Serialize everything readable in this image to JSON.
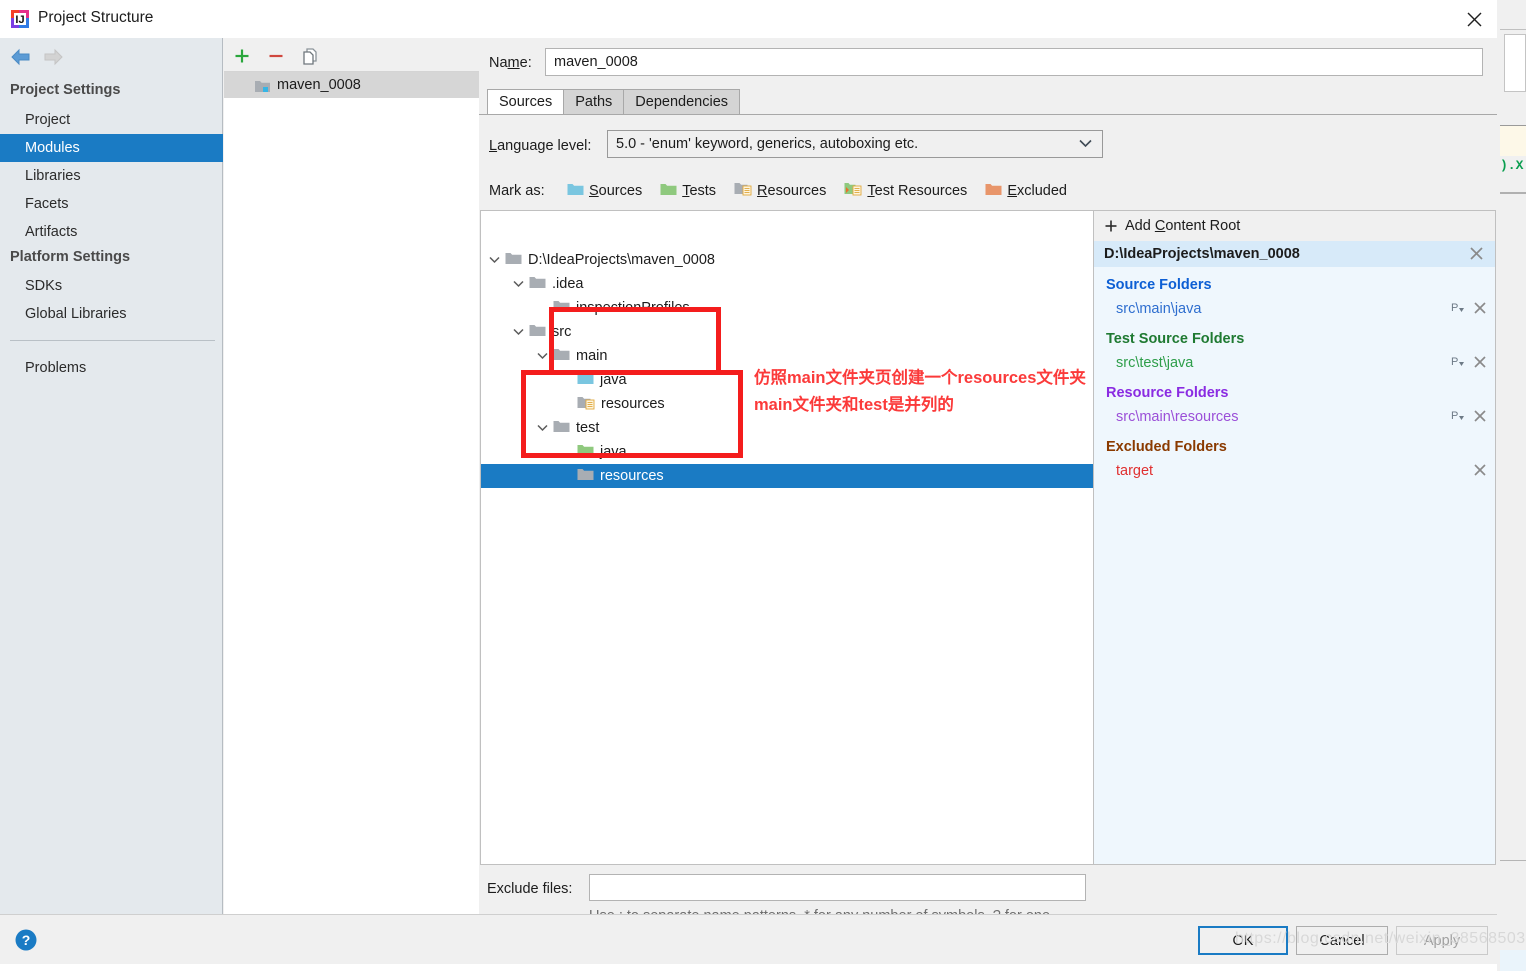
{
  "window": {
    "title": "Project Structure",
    "close_icon": "close-icon",
    "app_icon": "intellij-idea-icon"
  },
  "navigation": {
    "back_icon": "arrow-left-icon",
    "forward_icon": "arrow-right-icon"
  },
  "sidebar": {
    "groups": [
      {
        "label": "Project Settings"
      },
      {
        "label": "Platform Settings"
      }
    ],
    "items": [
      {
        "label": "Project",
        "selected": false
      },
      {
        "label": "Modules",
        "selected": true
      },
      {
        "label": "Libraries",
        "selected": false
      },
      {
        "label": "Facets",
        "selected": false
      },
      {
        "label": "Artifacts",
        "selected": false
      },
      {
        "label": "SDKs",
        "selected": false
      },
      {
        "label": "Global Libraries",
        "selected": false
      },
      {
        "label": "Problems",
        "selected": false
      }
    ]
  },
  "modules_panel": {
    "toolbar": {
      "add_icon": "plus-icon",
      "remove_icon": "minus-icon",
      "copy_icon": "copy-icon"
    },
    "module_name": "maven_0008",
    "module_icon": "module-folder-icon"
  },
  "main": {
    "name_label": "Name:",
    "name_value": "maven_0008",
    "tabs": [
      {
        "label": "Sources",
        "active": true
      },
      {
        "label": "Paths",
        "active": false
      },
      {
        "label": "Dependencies",
        "active": false
      }
    ],
    "language_level_label": "Language level:",
    "language_level_value": "5.0 - 'enum' keyword, generics, autoboxing etc.",
    "language_level_caret": "chevron-down-icon",
    "mark_as_label": "Mark as:",
    "mark_as_options": [
      {
        "label": "Sources",
        "color": "#7ac6e0",
        "icon": "sources-folder-icon",
        "accel": "S"
      },
      {
        "label": "Tests",
        "color": "#8fc97e",
        "icon": "tests-folder-icon",
        "accel": "T"
      },
      {
        "label": "Resources",
        "color": "#a8adb3",
        "icon": "resources-folder-icon",
        "accel": "R"
      },
      {
        "label": "Test Resources",
        "color": "#8fc97e",
        "icon": "test-resources-folder-icon",
        "accel": "T"
      },
      {
        "label": "Excluded",
        "color": "#e8956a",
        "icon": "excluded-folder-icon",
        "accel": "E"
      }
    ],
    "exclude_files_label": "Exclude files:",
    "exclude_files_value": "",
    "exclude_files_hint": "Use ; to separate name patterns, * for any number of symbols, ? for one."
  },
  "tree": {
    "rows": [
      {
        "label": "D:\\IdeaProjects\\maven_0008",
        "depth": 0,
        "twisty": "expanded",
        "folder": "plain",
        "selected": false
      },
      {
        "label": ".idea",
        "depth": 1,
        "twisty": "expanded",
        "folder": "plain",
        "selected": false
      },
      {
        "label": "inspectionProfiles",
        "depth": 2,
        "twisty": "none",
        "folder": "plain",
        "selected": false
      },
      {
        "label": "src",
        "depth": 1,
        "twisty": "expanded",
        "folder": "plain",
        "selected": false
      },
      {
        "label": "main",
        "depth": 2,
        "twisty": "expanded",
        "folder": "plain",
        "selected": false
      },
      {
        "label": "java",
        "depth": 3,
        "twisty": "none",
        "folder": "sources",
        "selected": false
      },
      {
        "label": "resources",
        "depth": 3,
        "twisty": "none",
        "folder": "resources",
        "selected": false
      },
      {
        "label": "test",
        "depth": 2,
        "twisty": "expanded",
        "folder": "plain",
        "selected": false
      },
      {
        "label": "java",
        "depth": 3,
        "twisty": "none",
        "folder": "tests",
        "selected": false
      },
      {
        "label": "resources",
        "depth": 3,
        "twisty": "none",
        "folder": "plain",
        "selected": true
      }
    ]
  },
  "content_root": {
    "add_label": "Add Content Root",
    "add_icon": "plus-icon",
    "root_path": "D:\\IdeaProjects\\maven_0008",
    "root_remove_icon": "close-icon",
    "sections": [
      {
        "header": "Source Folders",
        "header_color": "#0d5fd4",
        "paths": [
          {
            "path": "src\\main\\java",
            "color": "#2e6ecf",
            "has_package_prefix": true,
            "has_remove": true
          }
        ]
      },
      {
        "header": "Test Source Folders",
        "header_color": "#1f7a32",
        "paths": [
          {
            "path": "src\\test\\java",
            "color": "#2e9e4a",
            "has_package_prefix": true,
            "has_remove": true
          }
        ]
      },
      {
        "header": "Resource Folders",
        "header_color": "#8a2be2",
        "paths": [
          {
            "path": "src\\main\\resources",
            "color": "#9b4fd8",
            "has_package_prefix": true,
            "has_remove": true
          }
        ]
      },
      {
        "header": "Excluded Folders",
        "header_color": "#8a3a00",
        "paths": [
          {
            "path": "target",
            "color": "#e03030",
            "has_package_prefix": false,
            "has_remove": true
          }
        ]
      }
    ]
  },
  "footer": {
    "help_icon": "help-icon",
    "buttons": [
      {
        "label": "OK",
        "primary": true,
        "enabled": true
      },
      {
        "label": "Cancel",
        "primary": false,
        "enabled": true
      },
      {
        "label": "Apply",
        "primary": false,
        "enabled": false
      }
    ]
  },
  "annotations": {
    "color": "#fb3a3a",
    "box_color": "#f41d1d",
    "line1": "仿照main文件夹页创建一个resources文件夹",
    "line2": "main文件夹和test是并列的"
  },
  "watermark": "https://blog.csdn.net/weixin_38568503",
  "background": {
    "code_fragment": ").X"
  }
}
